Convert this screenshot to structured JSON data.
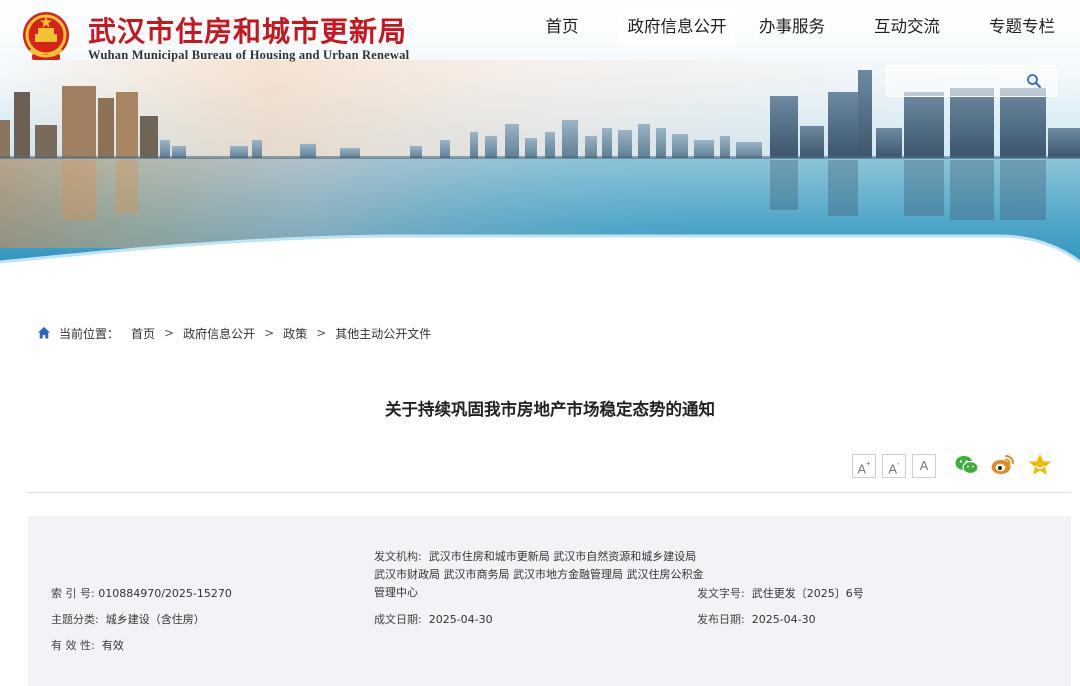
{
  "header": {
    "title": "武汉市住房和城市更新局",
    "subtitle": "Wuhan Municipal Bureau of Housing and Urban Renewal"
  },
  "nav": {
    "items": [
      {
        "label": "首页"
      },
      {
        "label": "政府信息公开"
      },
      {
        "label": "办事服务"
      },
      {
        "label": "互动交流"
      },
      {
        "label": "专题专栏"
      }
    ]
  },
  "search": {
    "placeholder": "",
    "icon": "search-icon"
  },
  "breadcrumb": {
    "prefix": "当前位置：",
    "items": [
      "首页",
      "政府信息公开",
      "政策",
      "其他主动公开文件"
    ],
    "separator": ">"
  },
  "article": {
    "title": "关于持续巩固我市房地产市场稳定态势的通知"
  },
  "tools": {
    "font_large": "A",
    "font_large_mark": "+",
    "font_small": "A",
    "font_small_mark": "-",
    "font_reset": "A",
    "share_icons": [
      "wechat-icon",
      "weibo-icon",
      "favorite-star-icon"
    ]
  },
  "meta": {
    "index_label": "索 引 号:",
    "index_value": "010884970/2025-15270",
    "topic_label": "主题分类:",
    "topic_value": "城乡建设（含住房）",
    "validity_label": "有 效 性:",
    "validity_value": "有效",
    "issuer_label": "发文机构:",
    "issuer_line1": "武汉市住房和城市更新局 武汉市自然资源和城乡建设局",
    "issuer_line2": "武汉市财政局 武汉市商务局 武汉市地方金融管理局 武汉住房公积金",
    "issuer_line3": "管理中心",
    "created_label": "成文日期:",
    "created_value": "2025-04-30",
    "doc_no_label": "发文字号:",
    "doc_no_value": "武住更发〔2025〕6号",
    "published_label": "发布日期:",
    "published_value": "2025-04-30"
  },
  "colors": {
    "title_red": "#c8161e",
    "nav_text": "#222222",
    "meta_bg": "#f2f3f7",
    "wechat_green": "#3dae3a",
    "weibo_orange": "#e8891b",
    "star_yellow": "#f5b800"
  }
}
